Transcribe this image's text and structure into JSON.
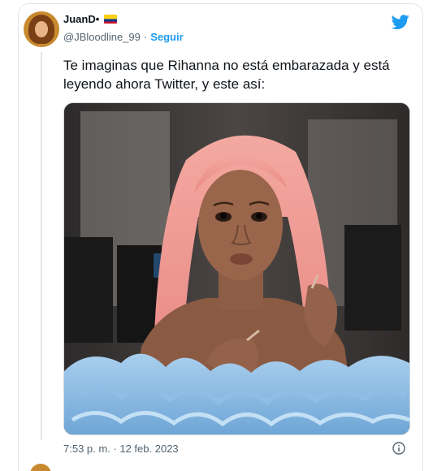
{
  "tweet": {
    "display_name": "JuanD•",
    "handle": "@JBloodline_99",
    "separator": "·",
    "follow_label": "Seguir",
    "text": "Te imaginas que Rihanna no está embarazada y está leyendo ahora Twitter, y este así:",
    "timestamp": "7:53 p. m. · 12 feb. 2023"
  },
  "icons": {
    "brand": "twitter-bird-icon",
    "info": "info-icon",
    "flag": "colombia-flag-icon"
  },
  "colors": {
    "accent": "#1d9bf0",
    "text_primary": "#0f1419",
    "text_secondary": "#536471",
    "border": "#cfd9de"
  }
}
